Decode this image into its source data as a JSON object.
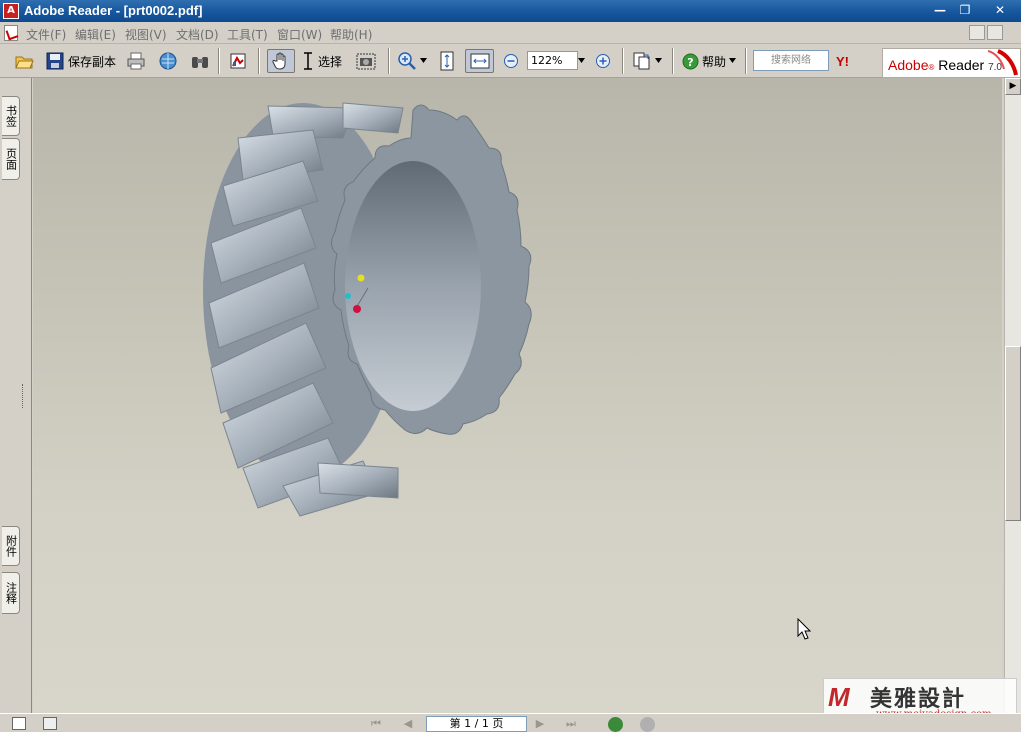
{
  "window": {
    "title": "Adobe Reader - [prt0002.pdf]",
    "min_glyph": "—",
    "restore_glyph": "❐",
    "close_glyph": "✕"
  },
  "menu": {
    "items": [
      "文件(F)",
      "编辑(E)",
      "视图(V)",
      "文档(D)",
      "工具(T)",
      "窗口(W)",
      "帮助(H)"
    ]
  },
  "toolbar": {
    "save_copy_label": "保存副本",
    "select_label": "选择",
    "zoom_value": "122%",
    "help_label": "帮助",
    "search_placeholder": "搜索网络",
    "yahoo_label": "Y!",
    "brand_adobe": "Adobe",
    "brand_reader": "Reader",
    "brand_version": "7.0"
  },
  "navtabs": {
    "bookmarks": "书签",
    "pages": "页面",
    "attachments": "附件",
    "comments": "注释"
  },
  "statusbar": {
    "page_display": "第 1 / 1 页"
  },
  "watermark": {
    "logo": "M",
    "cn_name": "美雅設計",
    "url": "www.meiyadesign.com"
  },
  "colors": {
    "titlebar": "#1a5aa0",
    "tire": "#9aa4ae",
    "accent_red": "#c00000"
  }
}
